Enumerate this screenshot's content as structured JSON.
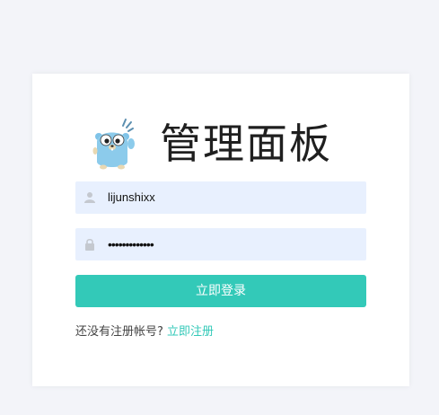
{
  "header": {
    "title": "管理面板",
    "logo_icon": "gopher-mascot-icon"
  },
  "form": {
    "username": {
      "value": "lijunshixx",
      "icon": "user-icon"
    },
    "password": {
      "value": "•••••••••••••",
      "icon": "lock-icon"
    },
    "login_button_label": "立即登录"
  },
  "register": {
    "prompt": "还没有注册帐号?",
    "link_label": "立即注册"
  },
  "colors": {
    "background": "#f3f4f9",
    "card": "#ffffff",
    "accent": "#33c9b8",
    "input_background": "#e8f0fe"
  }
}
